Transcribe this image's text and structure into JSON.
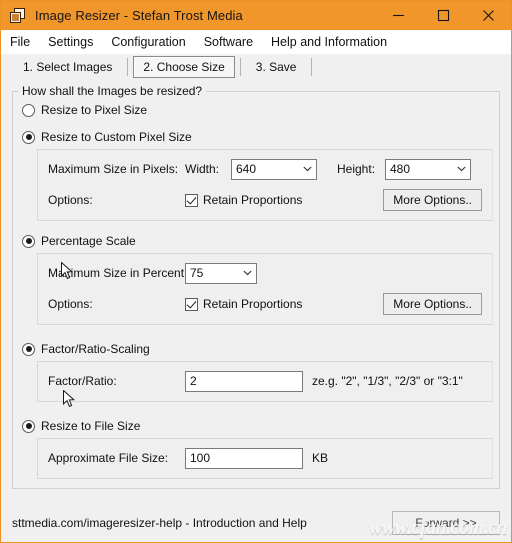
{
  "window": {
    "title": "Image Resizer - Stefan Trost Media",
    "icon": "image-stack-icon",
    "accent_color": "#F0962B",
    "surface_color": "#F0F0F0",
    "controls": [
      {
        "name": "minimize",
        "glyph": "minimize-icon"
      },
      {
        "name": "maximize",
        "glyph": "maximize-icon"
      },
      {
        "name": "close",
        "glyph": "close-icon"
      }
    ]
  },
  "menubar": {
    "items": [
      {
        "label": "File"
      },
      {
        "label": "Settings"
      },
      {
        "label": "Configuration"
      },
      {
        "label": "Software"
      },
      {
        "label": "Help and Information"
      }
    ]
  },
  "tabs": {
    "items": [
      {
        "label": "1. Select Images",
        "active": false
      },
      {
        "label": "2. Choose Size",
        "active": true
      },
      {
        "label": "3. Save",
        "active": false
      }
    ]
  },
  "main": {
    "group_title": "How shall the Images be resized?",
    "options": [
      {
        "id": "pixel-size",
        "label": "Resize to Pixel Size",
        "selected": false
      },
      {
        "id": "custom-pixel-size",
        "label": "Resize to Custom Pixel Size",
        "selected": true,
        "fields": {
          "size_label": "Maximum Size in Pixels:",
          "width_label": "Width:",
          "width_value": "640",
          "height_label": "Height:",
          "height_value": "480",
          "options_label": "Options:",
          "retain_label": "Retain Proportions",
          "retain_checked": true,
          "more_options_label": "More Options.."
        }
      },
      {
        "id": "percentage-scale",
        "label": "Percentage Scale",
        "selected": true,
        "fields": {
          "percent_label": "Maximum Size in Percent:",
          "percent_value": "75",
          "options_label": "Options:",
          "retain_label": "Retain Proportions",
          "retain_checked": true,
          "more_options_label": "More Options.."
        }
      },
      {
        "id": "factor-ratio-scaling",
        "label": "Factor/Ratio-Scaling",
        "selected": true,
        "fields": {
          "factor_label": "Factor/Ratio:",
          "factor_value": "2",
          "hint": "ze.g. \"2\", \"1/3\", \"2/3\" or \"3:1\""
        }
      },
      {
        "id": "resize-to-file-size",
        "label": "Resize to File Size",
        "selected": true,
        "fields": {
          "filesize_label": "Approximate File Size:",
          "filesize_value": "100",
          "unit": "KB"
        }
      }
    ]
  },
  "statusbar": {
    "help_text": "sttmedia.com/imageresizer-help - Introduction and Help",
    "forward_label": "Forward >>"
  },
  "overlay": {
    "watermark": "www.cfan.com.cn"
  }
}
